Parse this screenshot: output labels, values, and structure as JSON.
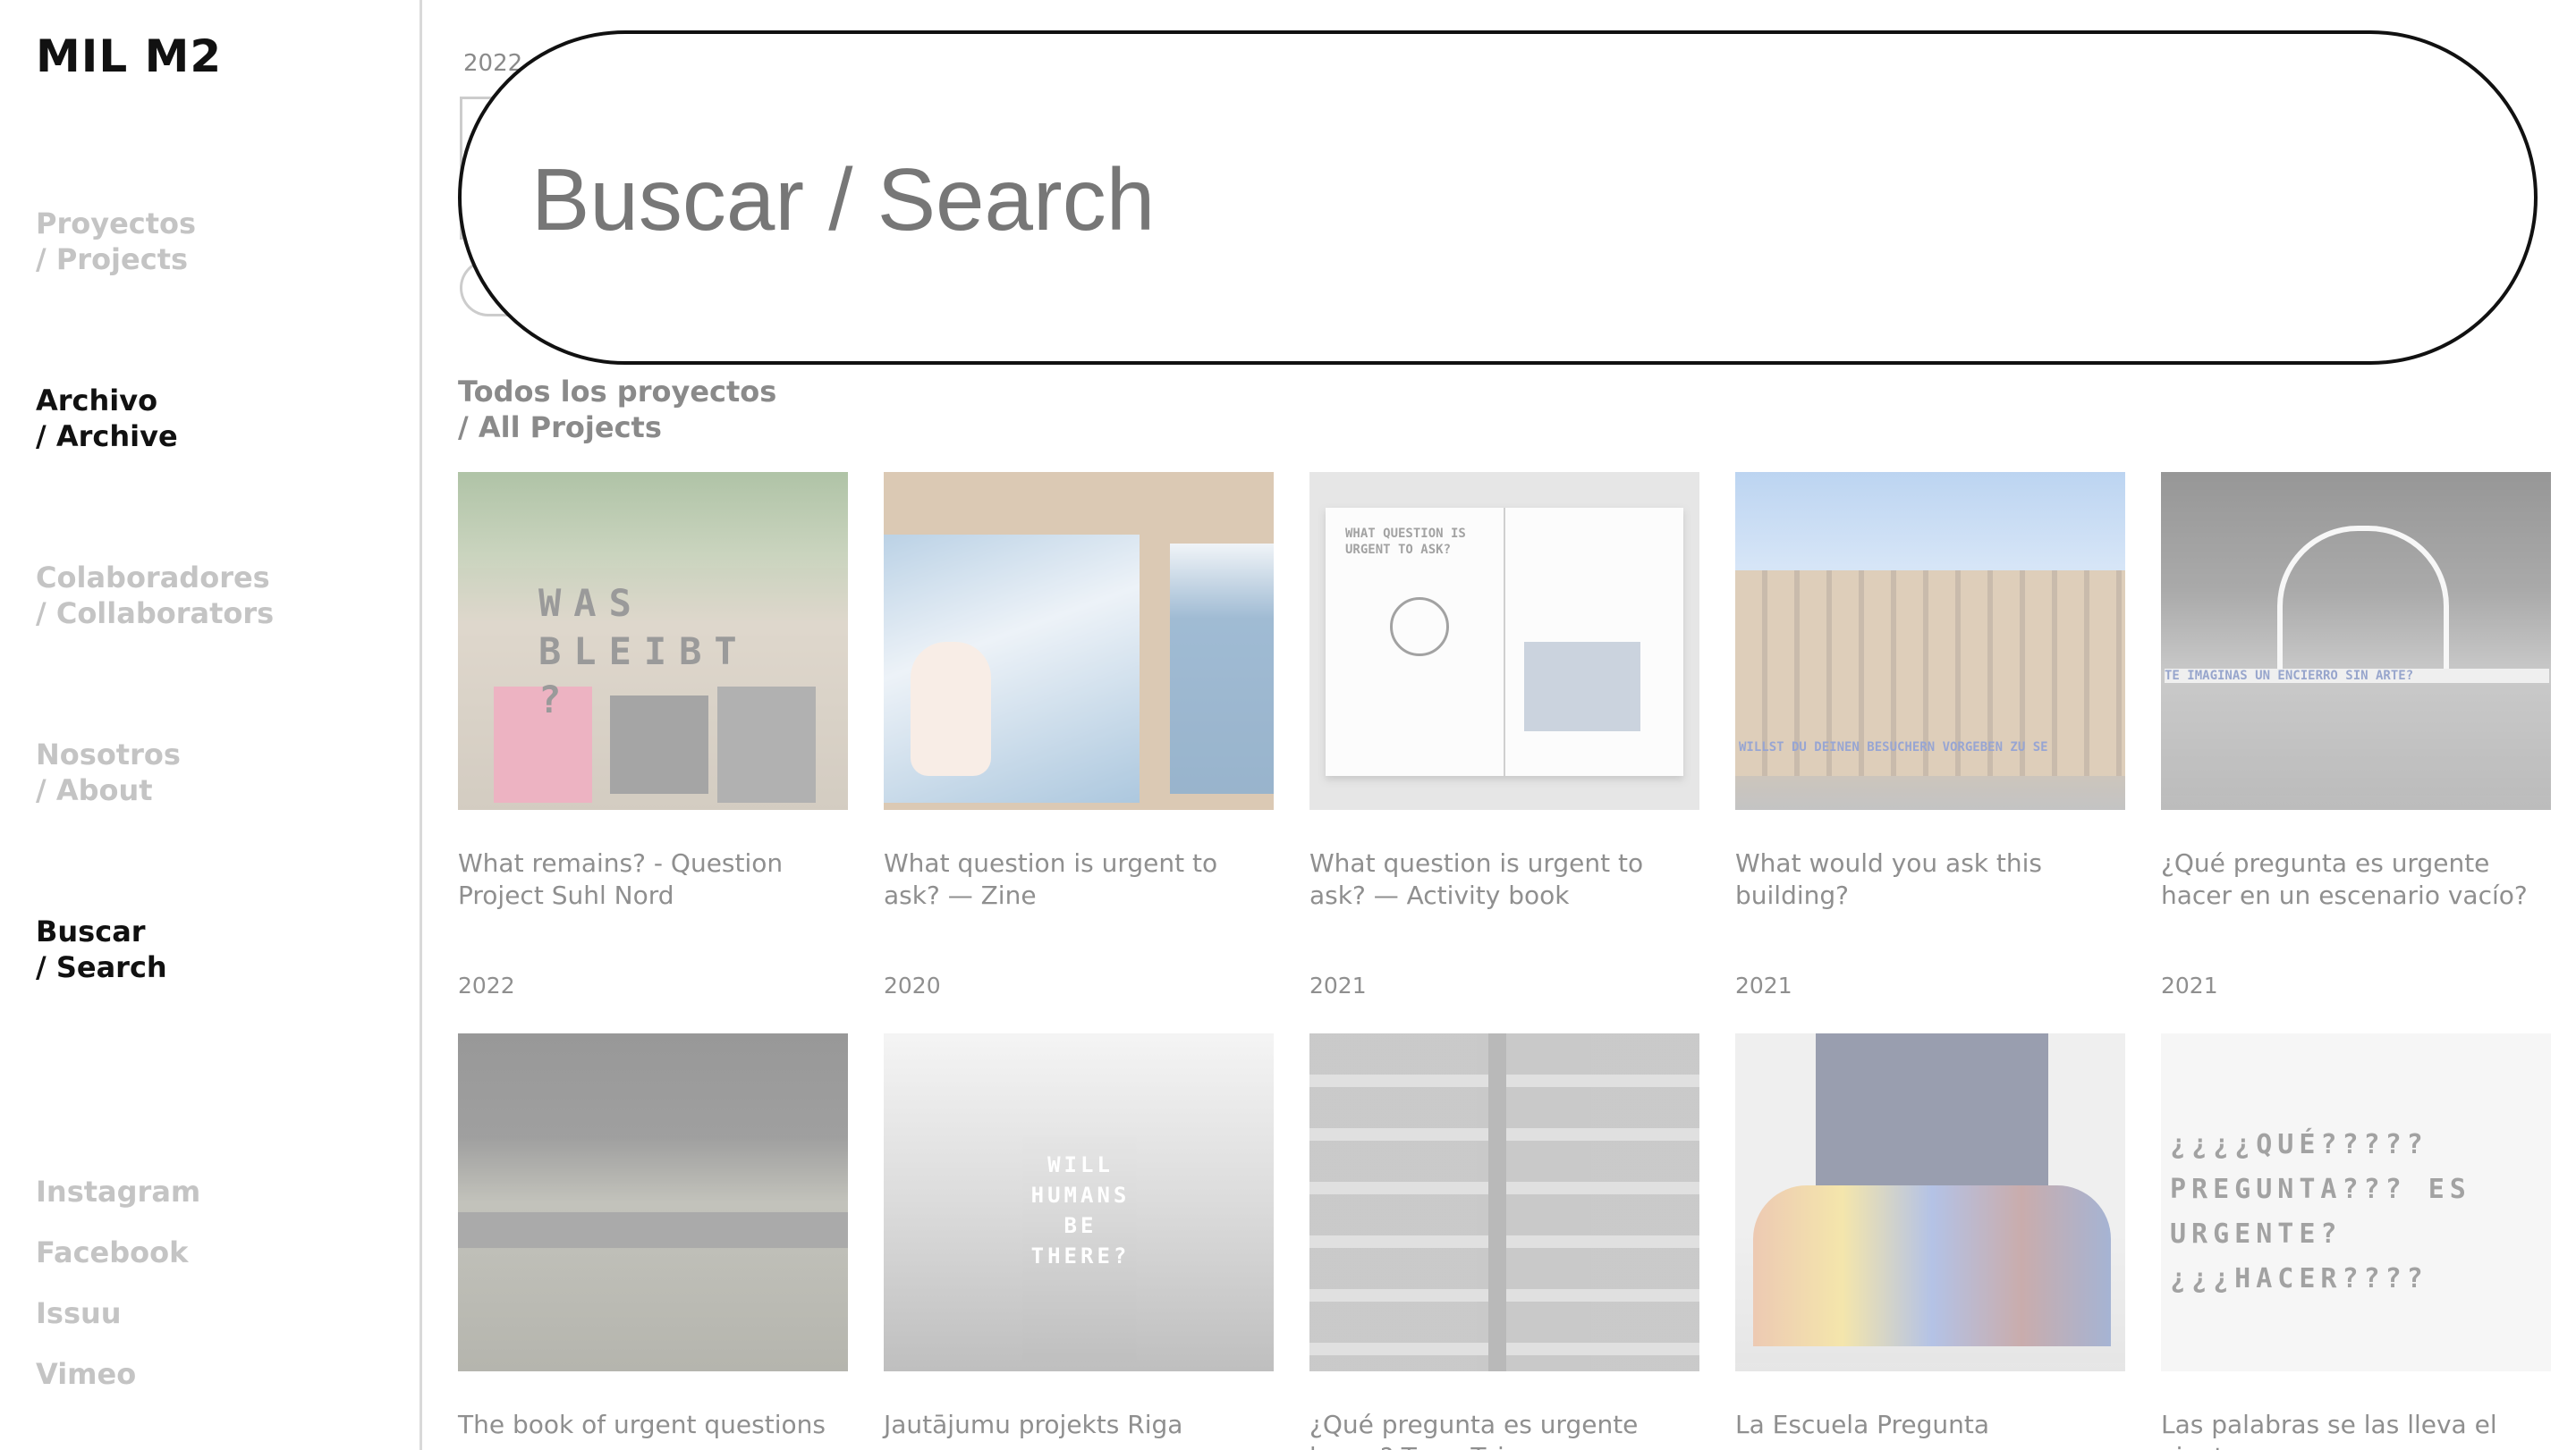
{
  "sidebar": {
    "logo": "MIL M2",
    "nav": [
      {
        "line1": "Proyectos",
        "line2": "/ Projects",
        "active": false
      },
      {
        "line1": "Archivo",
        "line2": "/ Archive",
        "active": true
      },
      {
        "line1": "Colaboradores",
        "line2": "/ Collaborators",
        "active": false
      },
      {
        "line1": "Nosotros",
        "line2": "/ About",
        "active": false
      },
      {
        "line1": "Buscar",
        "line2": "/ Search",
        "active": true
      }
    ],
    "social": [
      "Instagram",
      "Facebook",
      "Issuu",
      "Vimeo"
    ]
  },
  "search": {
    "placeholder": "Buscar / Search",
    "value": ""
  },
  "background_year": "2022",
  "section": {
    "line1": "Todos los proyectos",
    "line2": "/ All Projects"
  },
  "projects_row1": [
    {
      "title": "What remains? - Question Project Suhl Nord",
      "year": "2022",
      "thumb_text": "WAS BLEIBT ?"
    },
    {
      "title": "What question is urgent to ask? — Zine",
      "year": "2020",
      "thumb_text": ""
    },
    {
      "title": "What question is urgent to ask? — Activity book",
      "year": "2021",
      "thumb_text": "WHAT QUESTION IS URGENT TO ASK?"
    },
    {
      "title": "What would you ask this building?",
      "year": "2021",
      "thumb_text": "WILLST DU DEINEN BESUCHERN VORGEBEN ZU SE"
    },
    {
      "title": "¿Qué pregunta es urgente hacer en un escenario vacío?",
      "year": "2021",
      "thumb_text": "TE IMAGINAS UN ENCIERRO SIN ARTE?"
    }
  ],
  "projects_row2": [
    {
      "title": "The book of urgent questions",
      "thumb_text": ""
    },
    {
      "title": "Jautājumu projekts Riga",
      "thumb_text": "WILL HUMANS BE THERE?"
    },
    {
      "title": "¿Qué pregunta es urgente hacer? Torre Taismar",
      "thumb_text": ""
    },
    {
      "title": "La Escuela Pregunta",
      "thumb_text": ""
    },
    {
      "title": "Las palabras se las lleva el viento",
      "thumb_text": "¿¿¿¿QUÉ????? PREGUNTA??? ES URGENTE? ¿¿¿HACER????"
    }
  ]
}
